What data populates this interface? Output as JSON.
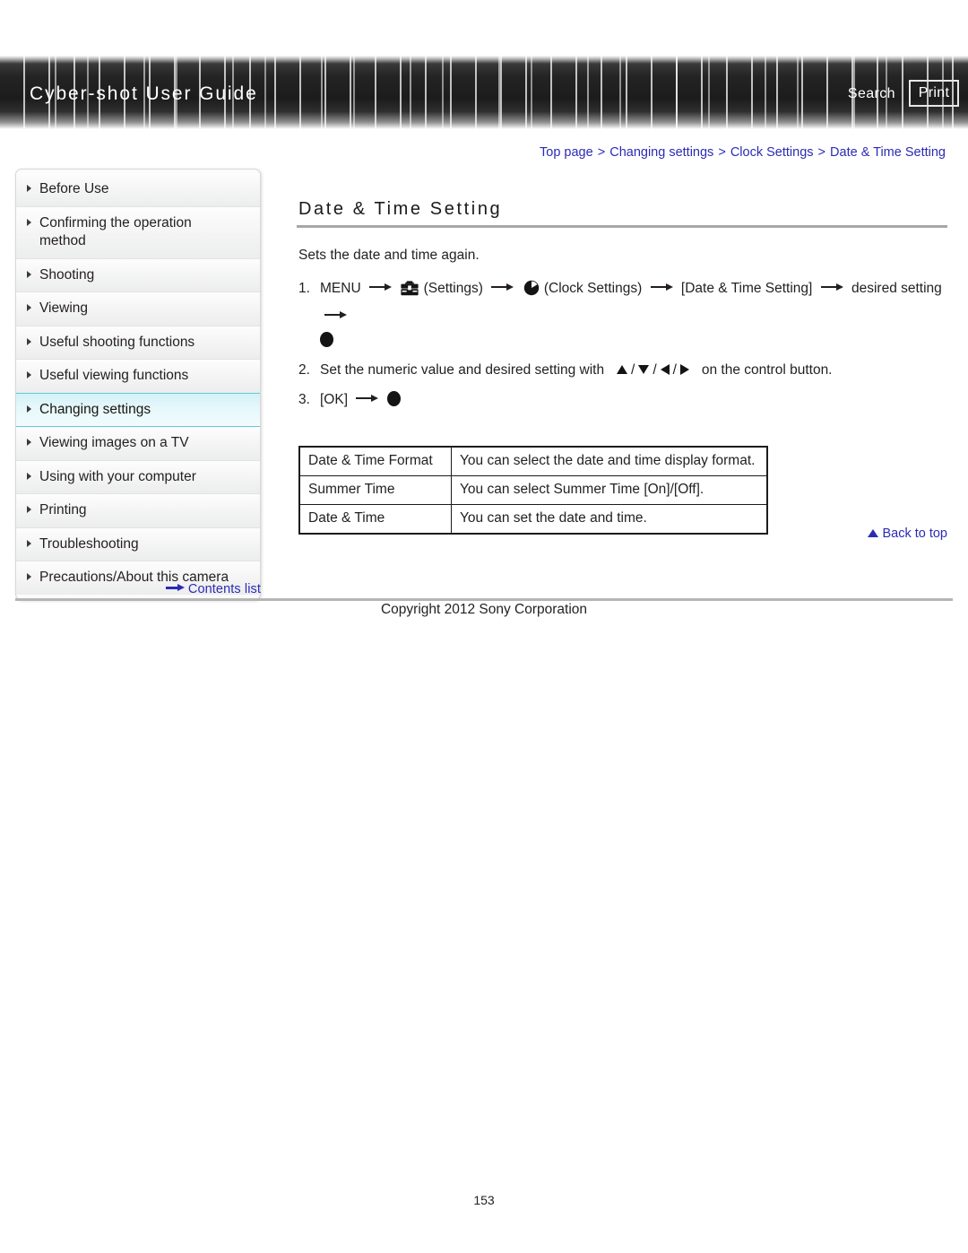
{
  "header": {
    "title": "Cyber-shot User Guide",
    "search_label": "Search",
    "print_label": "Print"
  },
  "breadcrumb": {
    "items": [
      "Top page",
      "Changing settings",
      "Clock Settings",
      "Date & Time Setting"
    ],
    "separator": ">"
  },
  "sidebar": {
    "items": [
      {
        "label": "Before Use",
        "active": false
      },
      {
        "label": "Confirming the operation method",
        "active": false
      },
      {
        "label": "Shooting",
        "active": false
      },
      {
        "label": "Viewing",
        "active": false
      },
      {
        "label": "Useful shooting functions",
        "active": false
      },
      {
        "label": "Useful viewing functions",
        "active": false
      },
      {
        "label": "Changing settings",
        "active": true
      },
      {
        "label": "Viewing images on a TV",
        "active": false
      },
      {
        "label": "Using with your computer",
        "active": false
      },
      {
        "label": "Printing",
        "active": false
      },
      {
        "label": "Troubleshooting",
        "active": false
      },
      {
        "label": "Precautions/About this camera",
        "active": false
      }
    ],
    "contents_link": "Contents list"
  },
  "main": {
    "title": "Date & Time Setting",
    "intro": "Sets the date and time again.",
    "steps": {
      "one": {
        "number": "1.",
        "menu": "MENU",
        "settings_label": "(Settings)",
        "clock_label": "(Clock Settings)",
        "bracket_item": "[Date & Time Setting]",
        "desired": "desired setting"
      },
      "two": {
        "number": "2.",
        "text_before": "Set the numeric value and desired setting with",
        "text_after": "on the control button."
      },
      "three": {
        "number": "3.",
        "ok": "[OK]"
      }
    },
    "table": {
      "rows": [
        {
          "key": "Date & Time Format",
          "value": "You can select the date and time display format."
        },
        {
          "key": "Summer Time",
          "value": "You can select Summer Time [On]/[Off]."
        },
        {
          "key": "Date & Time",
          "value": "You can set the date and time."
        }
      ]
    },
    "back_to_top": "Back to top"
  },
  "footer": {
    "copyright": "Copyright 2012 Sony Corporation",
    "page_number": "153"
  },
  "colors": {
    "link": "#2b2bb5",
    "banner_bg": "#1c1c1c",
    "active_nav": "#d3f1f7",
    "active_nav_border": "#63c8dc",
    "rule": "#a7a7a7"
  }
}
